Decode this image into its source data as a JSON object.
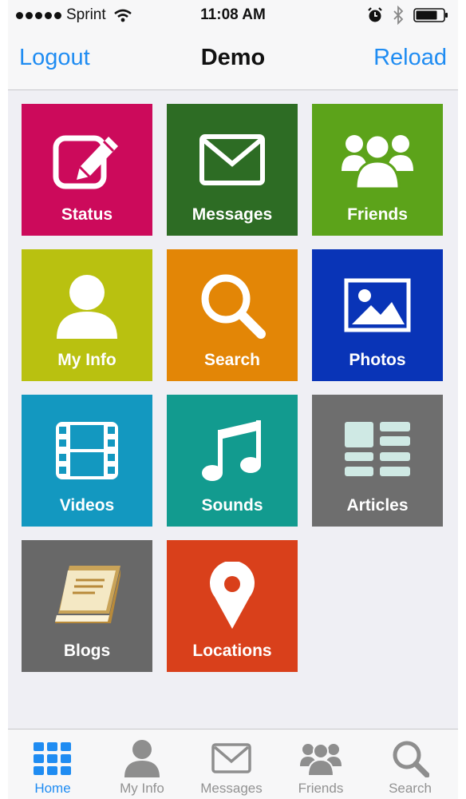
{
  "status_bar": {
    "carrier": "Sprint",
    "time": "11:08 AM",
    "icons": [
      "signal-dots-icon",
      "wifi-icon",
      "alarm-icon",
      "bluetooth-icon",
      "battery-icon"
    ]
  },
  "nav": {
    "left_button": "Logout",
    "title": "Demo",
    "right_button": "Reload"
  },
  "tiles": [
    {
      "label": "Status",
      "icon": "edit-icon",
      "color": "#cc0a5b"
    },
    {
      "label": "Messages",
      "icon": "envelope-icon",
      "color": "#2d6c24"
    },
    {
      "label": "Friends",
      "icon": "group-icon",
      "color": "#5ca31a"
    },
    {
      "label": "My Info",
      "icon": "user-icon",
      "color": "#b9c110"
    },
    {
      "label": "Search",
      "icon": "search-icon",
      "color": "#e38606"
    },
    {
      "label": "Photos",
      "icon": "photo-icon",
      "color": "#0934b7"
    },
    {
      "label": "Videos",
      "icon": "film-icon",
      "color": "#1398c0"
    },
    {
      "label": "Sounds",
      "icon": "music-icon",
      "color": "#129b8f"
    },
    {
      "label": "Articles",
      "icon": "articles-icon",
      "color": "#6e6e6e"
    },
    {
      "label": "Blogs",
      "icon": "book-icon",
      "color": "#686868"
    },
    {
      "label": "Locations",
      "icon": "map-pin-icon",
      "color": "#d9401b"
    }
  ],
  "tabbar": {
    "active_color": "#1f8cf2",
    "inactive_color": "#929292",
    "tabs": [
      {
        "label": "Home",
        "icon": "grid-icon",
        "active": true
      },
      {
        "label": "My Info",
        "icon": "user-icon",
        "active": false
      },
      {
        "label": "Messages",
        "icon": "envelope-icon",
        "active": false
      },
      {
        "label": "Friends",
        "icon": "group-icon",
        "active": false
      },
      {
        "label": "Search",
        "icon": "search-icon",
        "active": false
      }
    ]
  }
}
